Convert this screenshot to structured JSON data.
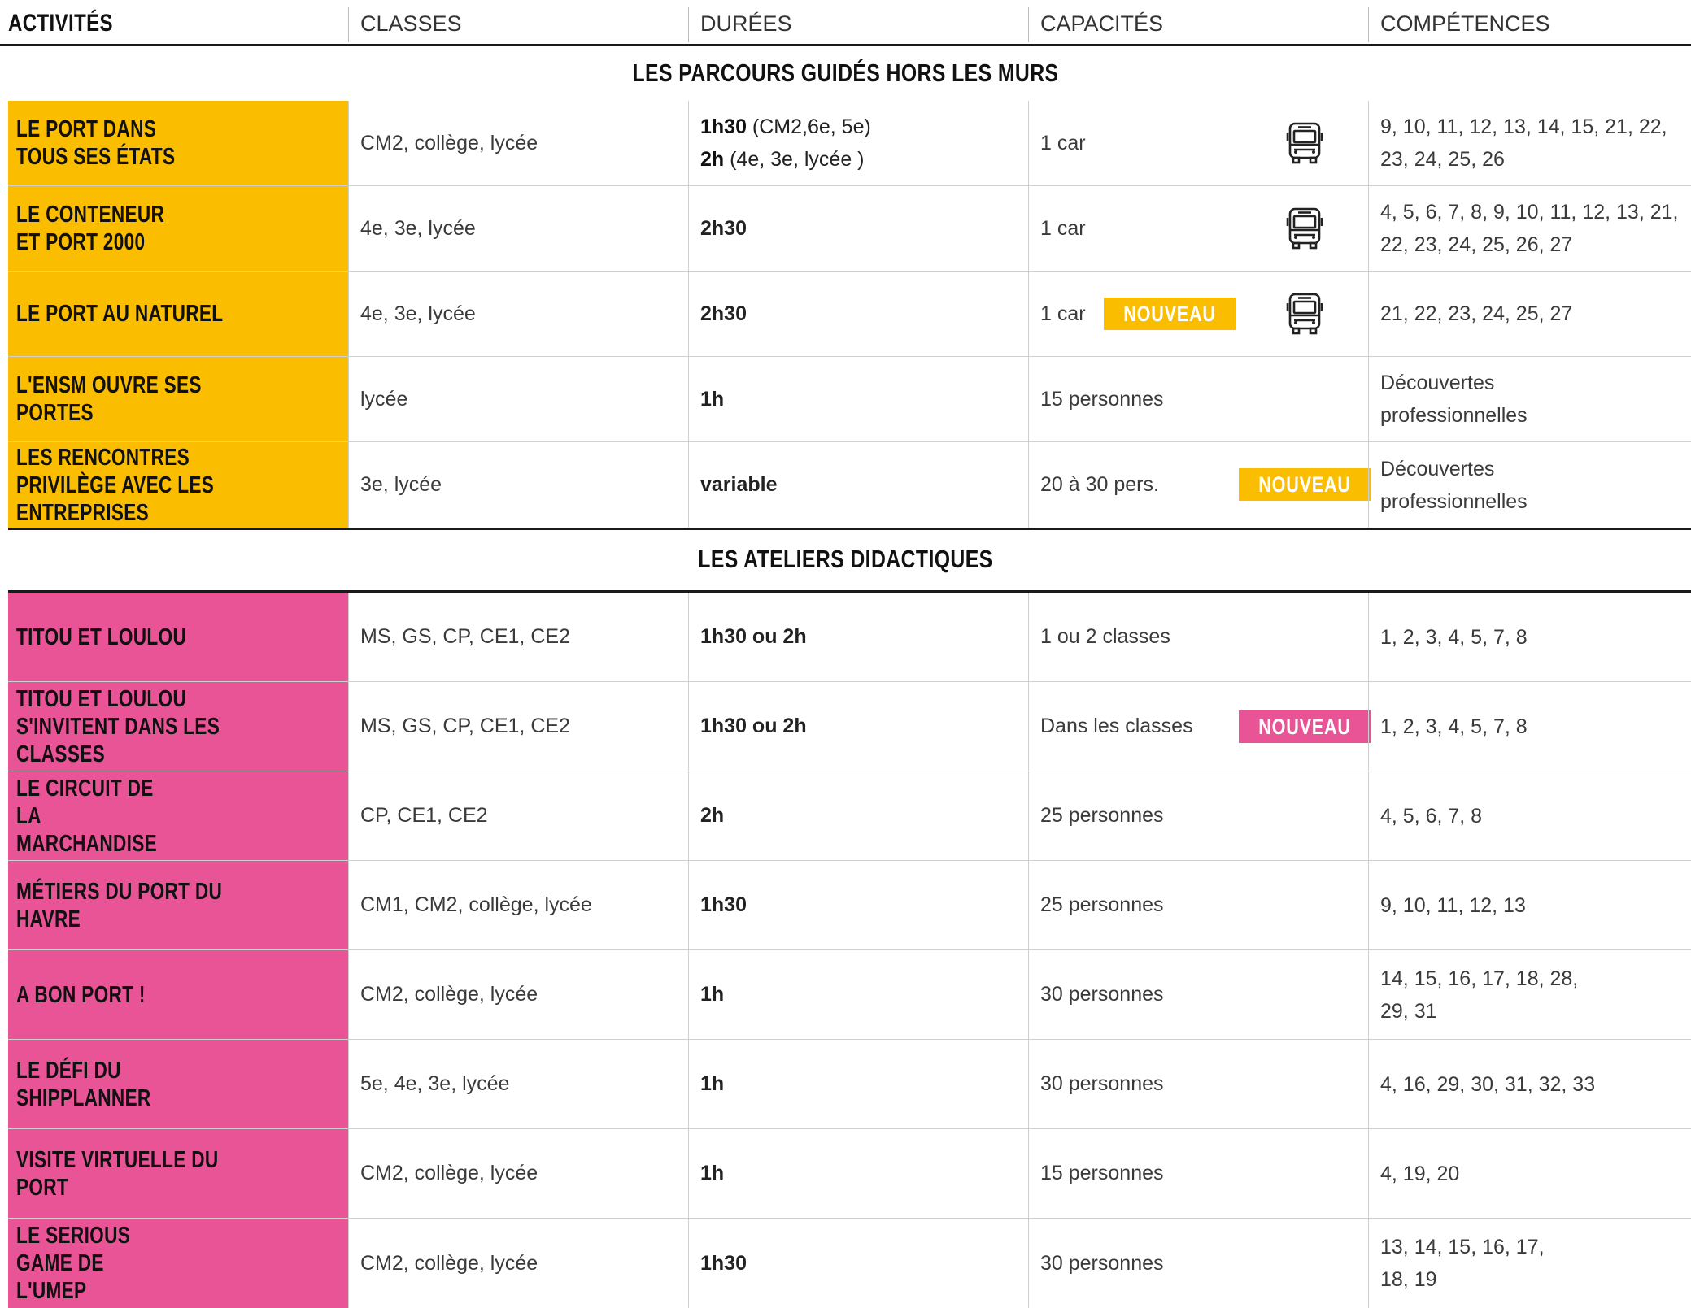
{
  "headers": {
    "activites": "ACTIVITÉS",
    "classes": "CLASSES",
    "durees": "DURÉES",
    "capacites": "CAPACITÉS",
    "competences": "COMPÉTENCES"
  },
  "sections": {
    "parcours_title": "LES PARCOURS GUIDÉS HORS LES MURS",
    "ateliers_title": "LES ATELIERS DIDACTIQUES"
  },
  "badge_label": "NOUVEAU",
  "colors": {
    "yellow": "#fbbd00",
    "pink": "#e85496",
    "rule": "#1a1a1a"
  },
  "icons": {
    "bus": "bus-icon"
  },
  "parcours": [
    {
      "activite": "LE PORT DANS TOUS SES ÉTATS",
      "classes": "CM2, collège, lycée",
      "duree_1_bold": "1h30",
      "duree_1_rest": " (CM2,6e, 5e)",
      "duree_2_bold": "2h",
      "duree_2_rest": " (4e, 3e, lycée )",
      "capacite": "1 car",
      "competences_1": "9, 10, 11, 12, 13, 14, 15,  21, 22,",
      "competences_2": "23, 24, 25, 26"
    },
    {
      "activite": "LE CONTENEUR ET PORT 2000",
      "classes": "4e, 3e, lycée",
      "duree": "2h30",
      "capacite": "1 car",
      "competences_1": "4, 5, 6, 7, 8, 9, 10, 11, 12, 13, 21,",
      "competences_2": "22, 23, 24, 25, 26, 27"
    },
    {
      "activite": "LE PORT AU NATUREL",
      "classes": "4e, 3e, lycée",
      "duree": "2h30",
      "capacite": "1 car",
      "competences_1": "21, 22, 23, 24, 25, 27"
    },
    {
      "activite": "L'ENSM OUVRE SES PORTES",
      "classes": "lycée",
      "duree": "1h",
      "capacite": "15 personnes",
      "competences_1": "Découvertes",
      "competences_2": "professionnelles"
    },
    {
      "activite": "LES RENCONTRES PRIVILÈGE AVEC LES ENTREPRISES",
      "classes": "3e, lycée",
      "duree": "variable",
      "capacite": "20 à 30 pers.",
      "competences_1": "Découvertes",
      "competences_2": "professionnelles"
    }
  ],
  "ateliers": [
    {
      "activite": "TITOU ET LOULOU",
      "classes": "MS, GS, CP, CE1, CE2",
      "duree": "1h30 ou 2h",
      "capacite": "1 ou 2 classes",
      "competences_1": "1, 2, 3, 4, 5, 7, 8"
    },
    {
      "activite": "TITOU ET LOULOU S'INVITENT DANS LES CLASSES",
      "classes": "MS, GS, CP, CE1, CE2",
      "duree": "1h30 ou 2h",
      "capacite": "Dans les classes",
      "competences_1": "1, 2, 3, 4, 5, 7, 8"
    },
    {
      "activite": "LE CIRCUIT DE LA MARCHANDISE",
      "classes": "CP, CE1, CE2",
      "duree": "2h",
      "capacite": "25 personnes",
      "competences_1": "4, 5, 6, 7, 8"
    },
    {
      "activite": "MÉTIERS DU PORT DU HAVRE",
      "classes": "CM1, CM2, collège, lycée",
      "duree": "1h30",
      "capacite": "25 personnes",
      "competences_1": "9, 10, 11, 12, 13"
    },
    {
      "activite": "A BON PORT !",
      "classes": "CM2, collège, lycée",
      "duree": "1h",
      "capacite": "30 personnes",
      "competences_1": "14, 15, 16, 17, 18, 28,",
      "competences_2": "29, 31"
    },
    {
      "activite": "LE DÉFI DU SHIPPLANNER",
      "classes": "5e, 4e, 3e, lycée",
      "duree": "1h",
      "capacite": "30 personnes",
      "competences_1": "4, 16, 29, 30, 31, 32, 33"
    },
    {
      "activite": "VISITE VIRTUELLE DU PORT",
      "classes": "CM2, collège, lycée",
      "duree": "1h",
      "capacite": "15 personnes",
      "competences_1": "4, 19, 20"
    },
    {
      "activite": "LE SERIOUS GAME DE L'UMEP",
      "classes": "CM2, collège, lycée",
      "duree": "1h30",
      "capacite": "30 personnes",
      "competences_1": "13, 14, 15, 16, 17,",
      "competences_2": "18, 19"
    }
  ]
}
